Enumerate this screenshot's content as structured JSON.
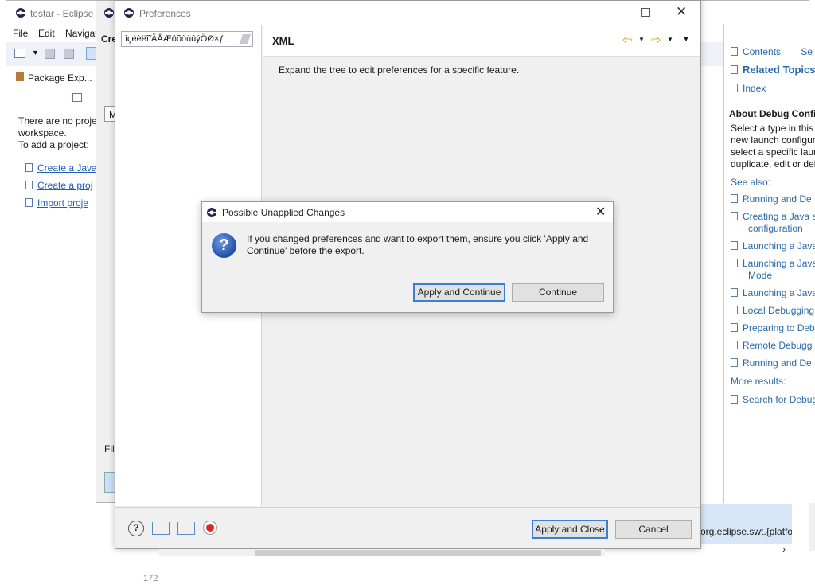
{
  "eclipse": {
    "title": "testar - Eclipse I",
    "menu": [
      "File",
      "Edit",
      "Navigat"
    ],
    "package_explorer": {
      "tab": "Package Exp...",
      "message": [
        "There are no projec",
        "workspace.",
        "To add a project:"
      ],
      "links": [
        "Create a Java",
        "Create a proj",
        "Import proje"
      ]
    },
    "status_text": "org.eclipse.swt.{platfor",
    "line_num": "172"
  },
  "back_dialog": {
    "title_fragment": "Cre",
    "filter_label": "Filt",
    "field_fragment": "M"
  },
  "help": {
    "contents": "Contents",
    "search_fragment": "Se",
    "related_topics": "Related Topics",
    "index": "Index",
    "about_title": "About Debug Config",
    "about_text": [
      "Select a type in this t",
      "new launch configur",
      "select a specific laun",
      "duplicate, edit or del"
    ],
    "see_also": "See also:",
    "links": [
      [
        "Running and De"
      ],
      [
        "Creating a Java a",
        "configuration"
      ],
      [
        "Launching a Java"
      ],
      [
        "Launching a Java",
        "Mode"
      ],
      [
        "Launching a Java"
      ],
      [
        "Local Debugging"
      ],
      [
        "Preparing to Deb"
      ],
      [
        "Remote Debugg"
      ],
      [
        "Running and De"
      ]
    ],
    "more_results": "More results:",
    "search_for": "Search for Debug"
  },
  "preferences": {
    "title": "Preferences",
    "filter_value": "ìçéèëîĩÄÅÆôõòùûýÖØ×ƒ",
    "page_title": "XML",
    "page_text": "Expand the tree to edit preferences for a specific feature.",
    "apply_close": "Apply and Close",
    "cancel": "Cancel"
  },
  "modal": {
    "title": "Possible Unapplied Changes",
    "message": "If you changed preferences and want to export them, ensure you click 'Apply and Continue' before the export.",
    "apply_continue": "Apply and Continue",
    "continue": "Continue"
  }
}
